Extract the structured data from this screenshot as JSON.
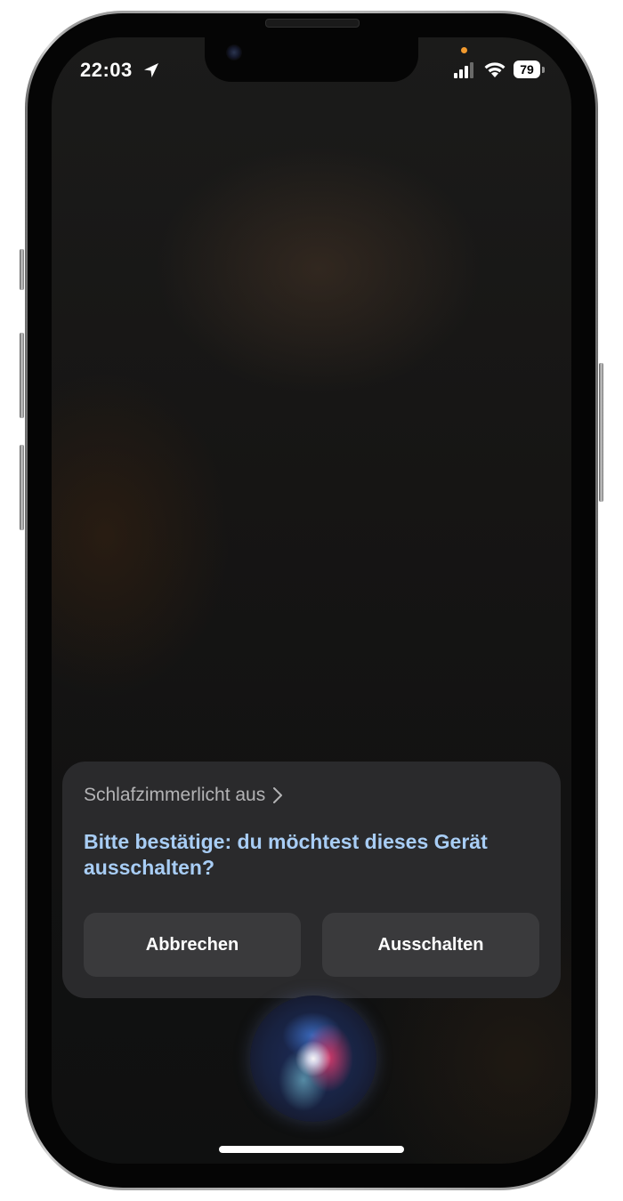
{
  "status_bar": {
    "time": "22:03",
    "location_icon": "location-arrow-icon",
    "signal_icon": "cellular-signal-icon",
    "wifi_icon": "wifi-icon",
    "battery_level": "79",
    "mic_indicator_color": "#f29a2e"
  },
  "siri_card": {
    "heading": "Schlafzimmerlicht aus",
    "heading_icon": "chevron-right-icon",
    "question": "Bitte bestätige: du möchtest dieses Gerät ausschalten?",
    "cancel_label": "Abbrechen",
    "confirm_label": "Ausschalten",
    "question_color": "#a8cdf5"
  },
  "siri": {
    "orb_icon": "siri-orb-icon"
  }
}
